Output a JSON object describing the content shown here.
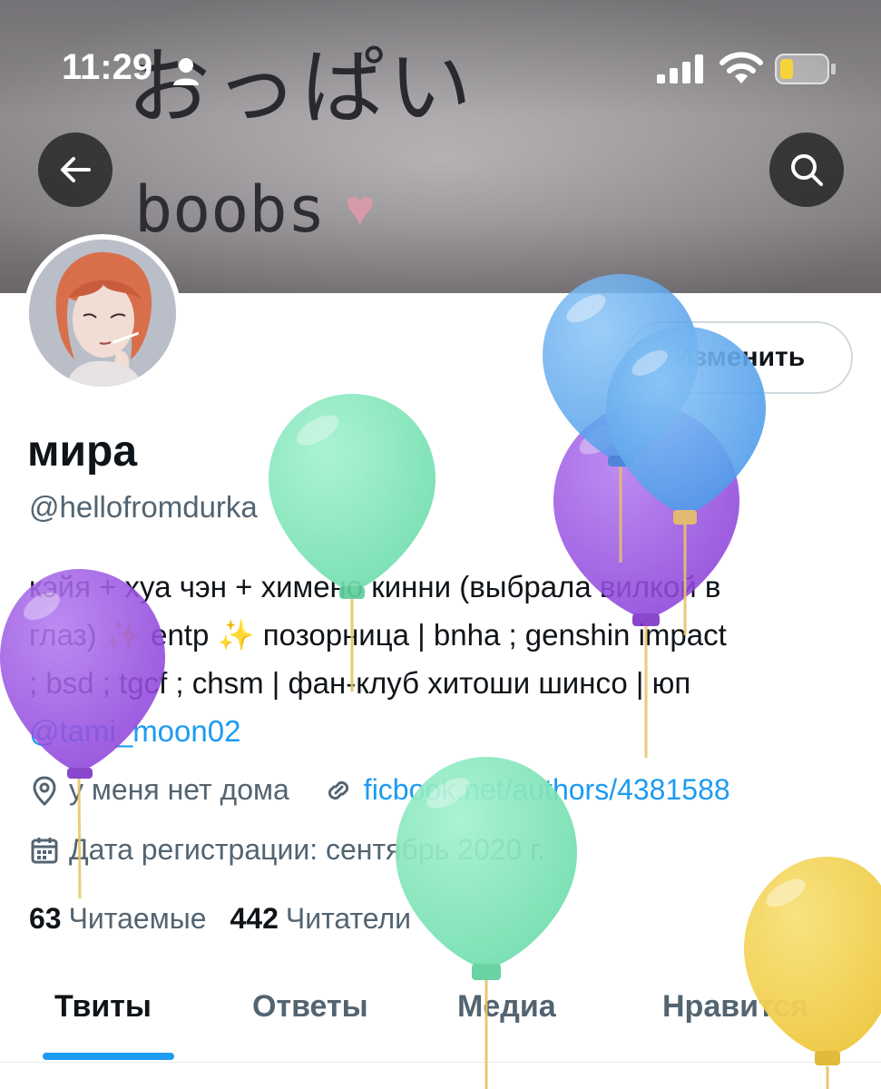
{
  "status_bar": {
    "time": "11:29"
  },
  "banner": {
    "text_jp": "おっぱい",
    "text_en": "boobs",
    "heart": "♥"
  },
  "profile": {
    "display_name": "мира",
    "handle": "@hellofromdurka",
    "edit_label": "Изменить",
    "bio_lines": [
      "кэйя + хуа чэн + химено кинни (выбрала вилкой в",
      "глаз) ✨ entp ✨ позорница | bnha ; genshin impact",
      "; bsd ; tgcf ; chsm | фан-клуб хитоши шинсо | юп"
    ],
    "bio_mention": "@tami_moon02",
    "location": "у меня нет дома",
    "link": "ficbook.net/authors/4381588",
    "joined": "Дата регистрации: сентябрь 2020 г.",
    "following_count": "63",
    "following_label": "Читаемые",
    "followers_count": "442",
    "followers_label": "Читатели"
  },
  "tabs": [
    {
      "label": "Твиты"
    },
    {
      "label": "Ответы"
    },
    {
      "label": "Медиа"
    },
    {
      "label": "Нравится"
    }
  ],
  "colors": {
    "accent": "#1d9bf0",
    "secondary_text": "#536471",
    "balloon_blue": "#5aa8ef",
    "balloon_green": "#7fe3b8",
    "balloon_purple": "#9a4ee0",
    "balloon_yellow": "#f1d04e"
  },
  "icons": [
    "back-arrow-icon",
    "search-icon",
    "person-icon",
    "signal-icon",
    "wifi-icon",
    "battery-icon",
    "location-pin-icon",
    "link-icon",
    "calendar-icon",
    "balloon-icon"
  ]
}
